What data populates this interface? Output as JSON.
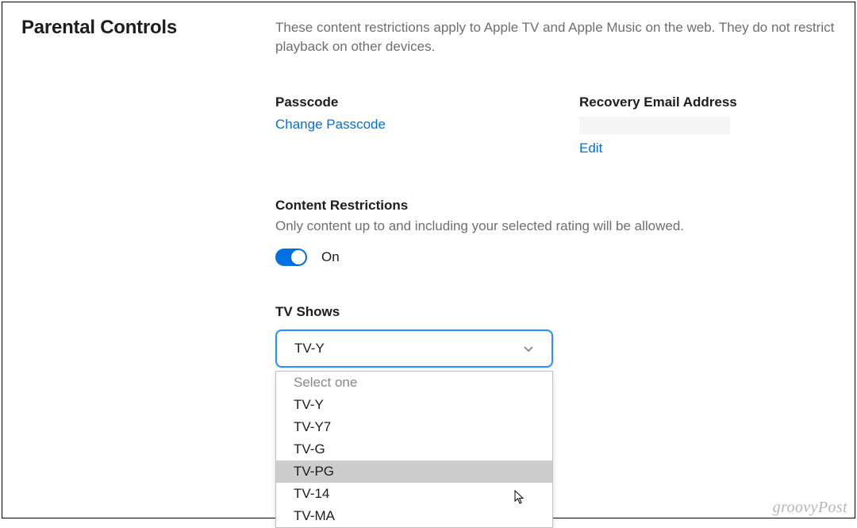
{
  "title": "Parental Controls",
  "description": "These content restrictions apply to Apple TV and Apple Music on the web. They do not restrict playback on other devices.",
  "passcode": {
    "label": "Passcode",
    "change_link": "Change Passcode"
  },
  "recovery": {
    "label": "Recovery Email Address",
    "edit_link": "Edit"
  },
  "restrictions": {
    "title": "Content Restrictions",
    "description": "Only content up to and including your selected rating will be allowed.",
    "toggle_state": "On"
  },
  "tv_shows": {
    "label": "TV Shows",
    "selected": "TV-Y",
    "options": [
      "Select one",
      "TV-Y",
      "TV-Y7",
      "TV-G",
      "TV-PG",
      "TV-14",
      "TV-MA"
    ],
    "highlighted": "TV-PG"
  },
  "watermark": "groovyPost"
}
